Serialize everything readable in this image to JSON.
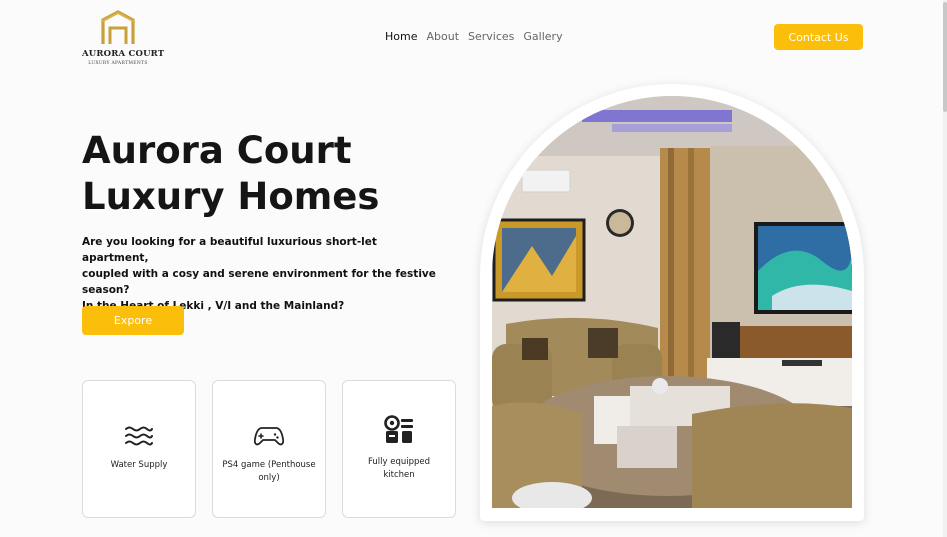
{
  "header": {
    "logo_name": "AURORA COURT",
    "logo_tagline": "LUXURY APARTMENTS",
    "nav": [
      "Home",
      "About",
      "Services",
      "Gallery"
    ],
    "active_nav": "Home",
    "contact_label": "Contact Us"
  },
  "hero": {
    "title_line1": "Aurora Court",
    "title_line2": "Luxury Homes",
    "description_line1": "Are you looking for a beautiful luxurious short-let apartment,",
    "description_line2": "coupled with a cosy and serene environment for the festive season?",
    "description_line3": "In the Heart of Lekki , V/I and the Mainland?",
    "explore_label": "Expore"
  },
  "features": [
    {
      "label": "Water Supply",
      "icon": "water-icon"
    },
    {
      "label": "PS4 game (Penthouse only)",
      "icon": "gamepad-icon"
    },
    {
      "label": "Fully equipped kitchen",
      "icon": "kitchen-icon"
    }
  ],
  "colors": {
    "accent": "#fbbf0b",
    "logo_gold": "#c9a13b"
  }
}
